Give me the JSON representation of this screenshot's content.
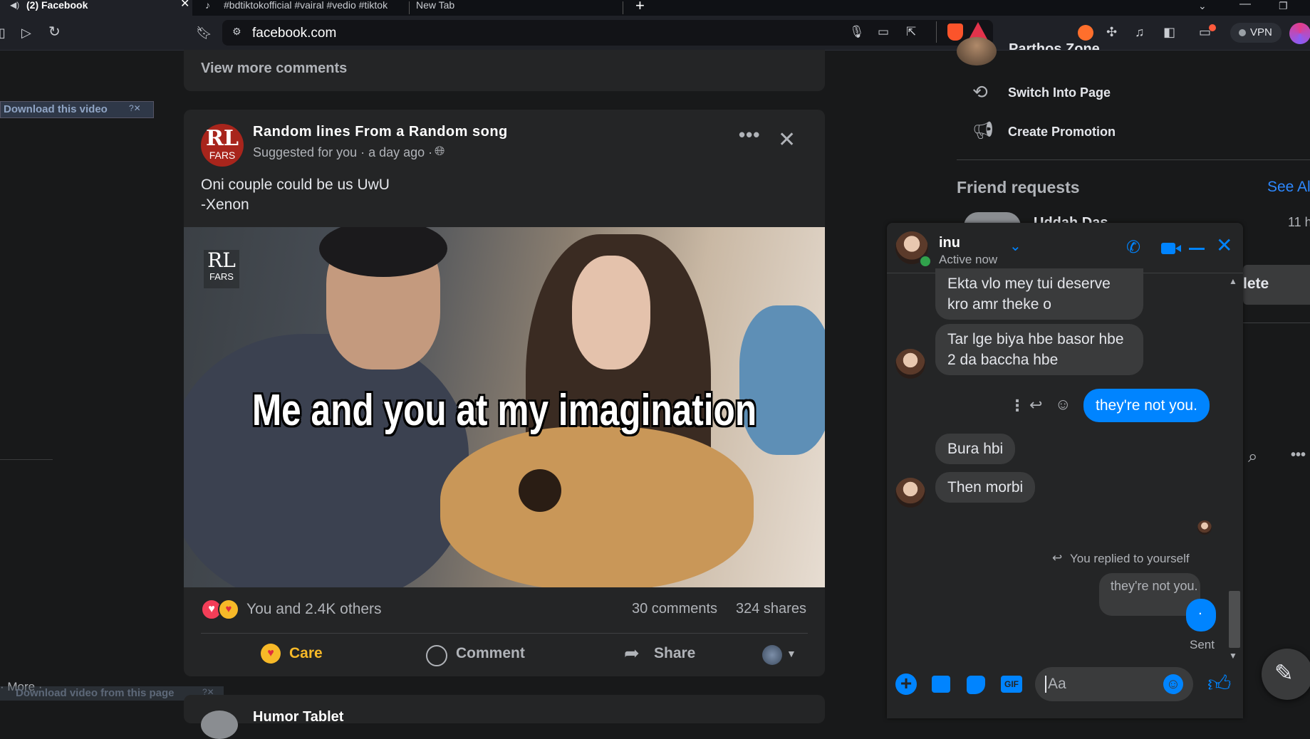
{
  "browser": {
    "tabs": [
      {
        "label": "(2) Facebook",
        "active": true
      },
      {
        "label": "#bdtiktokofficial #vairal #vedio #tiktok",
        "active": false
      },
      {
        "label": "New Tab",
        "active": false
      }
    ],
    "url": "facebook.com",
    "vpn_label": "VPN"
  },
  "feed": {
    "prev_post": {
      "view_more": "View more comments"
    },
    "download_overlay": {
      "top": "Download this video",
      "bottom": "Download video from this page",
      "more": "· More ·"
    },
    "post": {
      "page_name": "Random lines From a Random song",
      "avatar_text_top": "RL",
      "avatar_text_bottom": "FARS",
      "meta": "Suggested for you · a day ago ·",
      "caption_line1": "Oni couple could be us UwU",
      "caption_line2": "-Xenon",
      "image_caption": "Me and you at my imagination",
      "watermark_top": "RL",
      "watermark_bottom": "FARS",
      "reactions_text": "You and 2.4K others",
      "comments_count": "30 comments",
      "shares_count": "324 shares",
      "actions": {
        "care": "Care",
        "comment": "Comment",
        "share": "Share"
      }
    },
    "next_post_title": "Humor Tablet"
  },
  "right_sidebar": {
    "profile_partial": "Parthos Zone",
    "menu": [
      {
        "label": "Switch Into Page",
        "icon": "switch-profile-icon"
      },
      {
        "label": "Create Promotion",
        "icon": "megaphone-icon"
      }
    ],
    "friend_requests": {
      "title": "Friend requests",
      "see_all": "See All",
      "name_partial": "Uddah Das",
      "time_partial": "11 h",
      "delete_partial": "lete"
    }
  },
  "chat": {
    "name": "inu",
    "status": "Active now",
    "messages": [
      {
        "from": "them",
        "text_line1": "Ekta vlo mey tui deserve",
        "text_line2": "kro amr theke o"
      },
      {
        "from": "them",
        "text_line1": "Tar lge biya hbe basor hbe",
        "text_line2": "2 da baccha hbe"
      },
      {
        "from": "me",
        "text": "they're not you."
      },
      {
        "from": "them",
        "text": "Bura hbi"
      },
      {
        "from": "them",
        "text": "Then morbi"
      }
    ],
    "replied_label": "You replied to yourself",
    "quoted_text": "they're not you.",
    "my_reply": ".",
    "sent_label": "Sent",
    "input_placeholder": "Aa"
  },
  "colors": {
    "accent": "#0084ff",
    "care": "#f7b928",
    "bg": "#18191a",
    "card": "#242526"
  }
}
